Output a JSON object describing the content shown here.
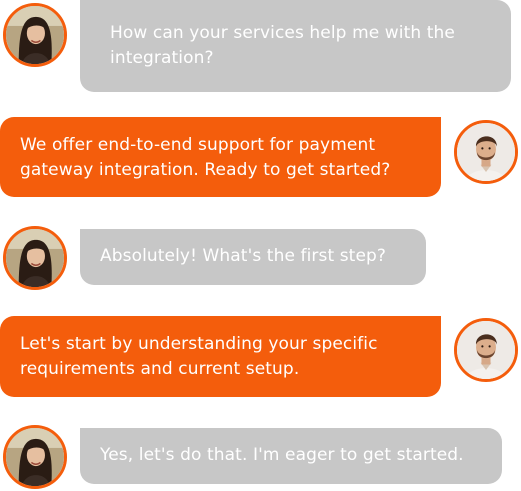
{
  "conversation": {
    "messages": [
      {
        "sender": "customer",
        "text": "How can your services help me with the\nintegration?"
      },
      {
        "sender": "agent",
        "text": "We offer end-to-end support for payment\ngateway integration. Ready to get started?"
      },
      {
        "sender": "customer",
        "text": "Absolutely! What's the first step?"
      },
      {
        "sender": "agent",
        "text": "Let's start by understanding your specific\nrequirements and current setup."
      },
      {
        "sender": "customer",
        "text": "Yes, let's do that. I'm eager to get started."
      }
    ]
  },
  "colors": {
    "customer_bubble": "#c7c7c7",
    "agent_bubble": "#f45d0c",
    "avatar_ring": "#f45d0c",
    "text": "#ffffff"
  },
  "icons": {
    "customer_avatar": "woman-photo-avatar",
    "agent_avatar": "man-photo-avatar"
  }
}
